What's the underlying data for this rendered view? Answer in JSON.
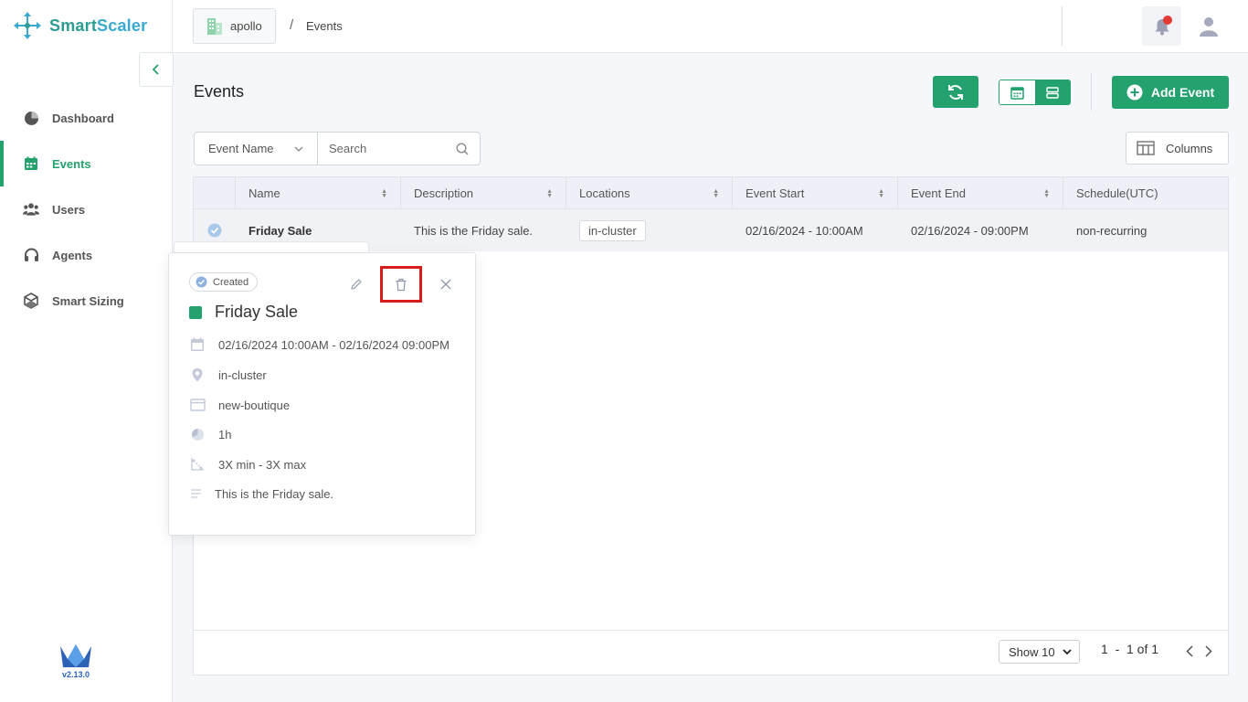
{
  "app": {
    "logo_text_a": "Smart",
    "logo_text_b": "Scaler",
    "version": "v2.13.0"
  },
  "breadcrumb": {
    "cluster": "apollo",
    "separator": "/",
    "page": "Events"
  },
  "sidebar": {
    "items": [
      {
        "label": "Dashboard",
        "icon": "pie-chart-icon"
      },
      {
        "label": "Events",
        "icon": "calendar-icon"
      },
      {
        "label": "Users",
        "icon": "users-icon"
      },
      {
        "label": "Agents",
        "icon": "headset-icon"
      },
      {
        "label": "Smart Sizing",
        "icon": "cube-icon"
      }
    ],
    "active": "Events"
  },
  "header": {
    "title": "Events",
    "add_label": "Add Event"
  },
  "filter": {
    "field": "Event Name",
    "search_placeholder": "Search"
  },
  "toolbar": {
    "columns_label": "Columns"
  },
  "table": {
    "columns": [
      "Name",
      "Description",
      "Locations",
      "Event Start",
      "Event End",
      "Schedule(UTC)"
    ],
    "rows": [
      {
        "name": "Friday Sale",
        "description": "This is the Friday sale.",
        "location": "in-cluster",
        "start": "02/16/2024 - 10:00AM",
        "end": "02/16/2024 - 09:00PM",
        "schedule": "non-recurring"
      }
    ]
  },
  "pagination": {
    "show_label": "Show 10",
    "range": "1  -  1 of 1"
  },
  "popover": {
    "status": "Created",
    "title": "Friday Sale",
    "datetime": "02/16/2024 10:00AM - 02/16/2024 09:00PM",
    "location": "in-cluster",
    "namespace": "new-boutique",
    "duration": "1h",
    "scaling": "3X min - 3X max",
    "description": "This is the Friday sale."
  },
  "colors": {
    "brand_green": "#23a26d",
    "alert_red": "#e53935",
    "highlight_red": "#d81b1b"
  }
}
